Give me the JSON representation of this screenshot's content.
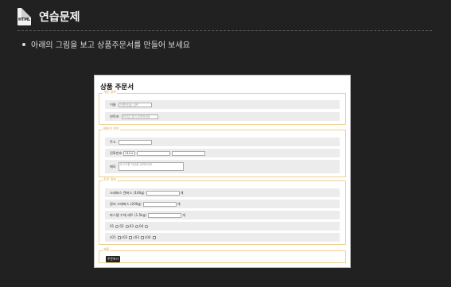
{
  "header": {
    "icon_label": "HTML",
    "title": "연습문제"
  },
  "instruction": "아래의 그림을 보고 상품주문서를 만들어 보세요",
  "form": {
    "title": "상품 주문서",
    "personal": {
      "legend": "개인 정보",
      "name_label": "이름",
      "name_placeholder": "이름(한글) 입력",
      "phone_label": "연락처",
      "phone_placeholder": "하이픈 없이 입력하세요"
    },
    "delivery": {
      "legend": "배송지 정보",
      "address_label": "주소",
      "phone_label": "전화번호",
      "phone_select": "010 ▾",
      "memo_label": "메모",
      "memo_placeholder": "요구사항 작성을 입력하세요"
    },
    "product": {
      "legend": "주문 정보",
      "items": [
        {
          "label": "크레파스 캔버스 (100g)",
          "unit": "개"
        },
        {
          "label": "컬러 크레파스 (200g)",
          "unit": "개"
        },
        {
          "label": "파스텔 수채 세트 (1.5kg)",
          "unit": "개"
        }
      ],
      "radio_options": [
        "01",
        "02",
        "03",
        "04"
      ],
      "check_options": [
        "c01",
        "c02",
        "c03",
        "c04"
      ]
    },
    "submit": {
      "legend": "제출",
      "button": "주문하기"
    }
  }
}
